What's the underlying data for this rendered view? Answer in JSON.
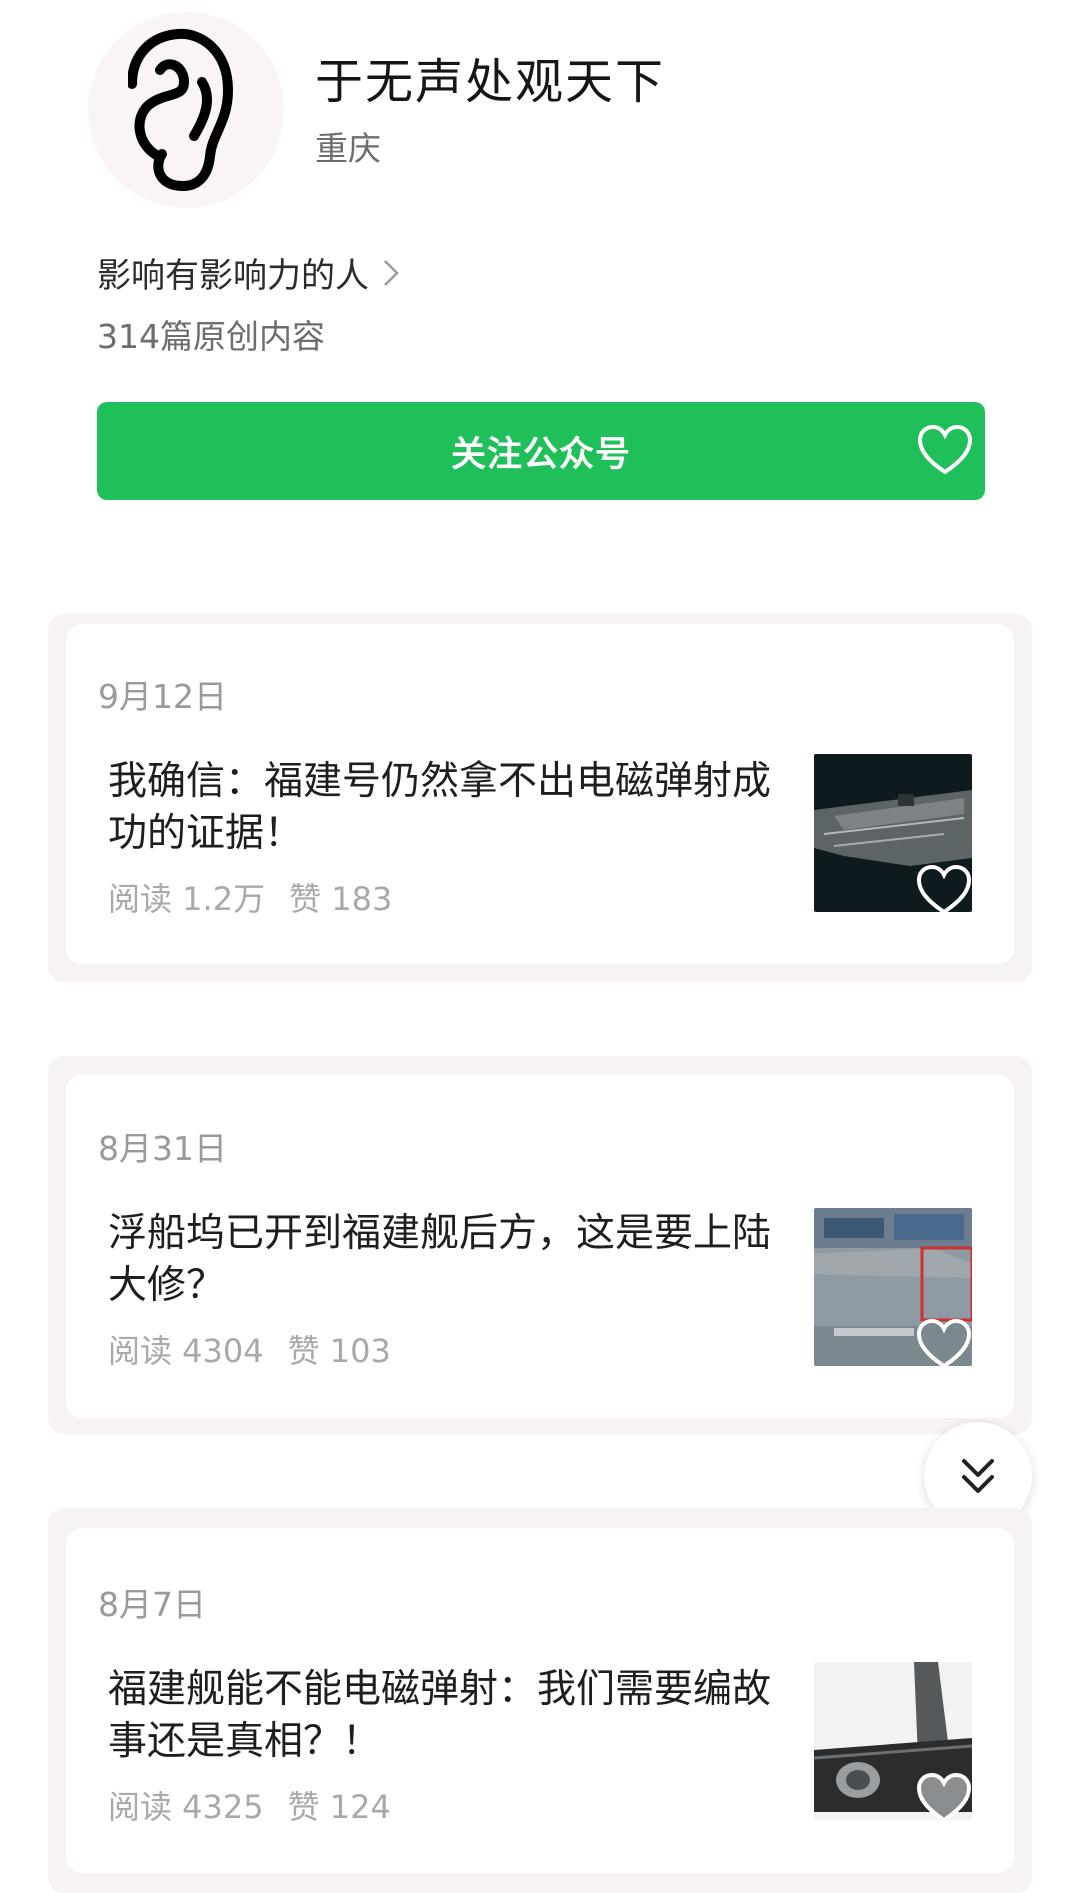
{
  "profile": {
    "name": "于无声处观天下",
    "region": "重庆",
    "slogan": "影响有影响力的人",
    "article_count": "314篇原创内容",
    "avatar_icon": "ear-icon"
  },
  "follow_button": {
    "label": "关注公众号",
    "color": "#1fbf5a"
  },
  "articles": [
    {
      "date": "9月12日",
      "title": "我确信：福建号仍然拿不出电磁弹射成功的证据！",
      "reads": "阅读 1.2万",
      "likes": "赞 183"
    },
    {
      "date": "8月31日",
      "title": "浮船坞已开到福建舰后方，这是要上陆大修？",
      "reads": "阅读 4304",
      "likes": "赞 103"
    },
    {
      "date": "8月7日",
      "title": "福建舰能不能电磁弹射：我们需要编故事还是真相？！",
      "reads": "阅读 4325",
      "likes": "赞 124"
    }
  ],
  "scroll_button_icon": "double-chevron-down-icon"
}
